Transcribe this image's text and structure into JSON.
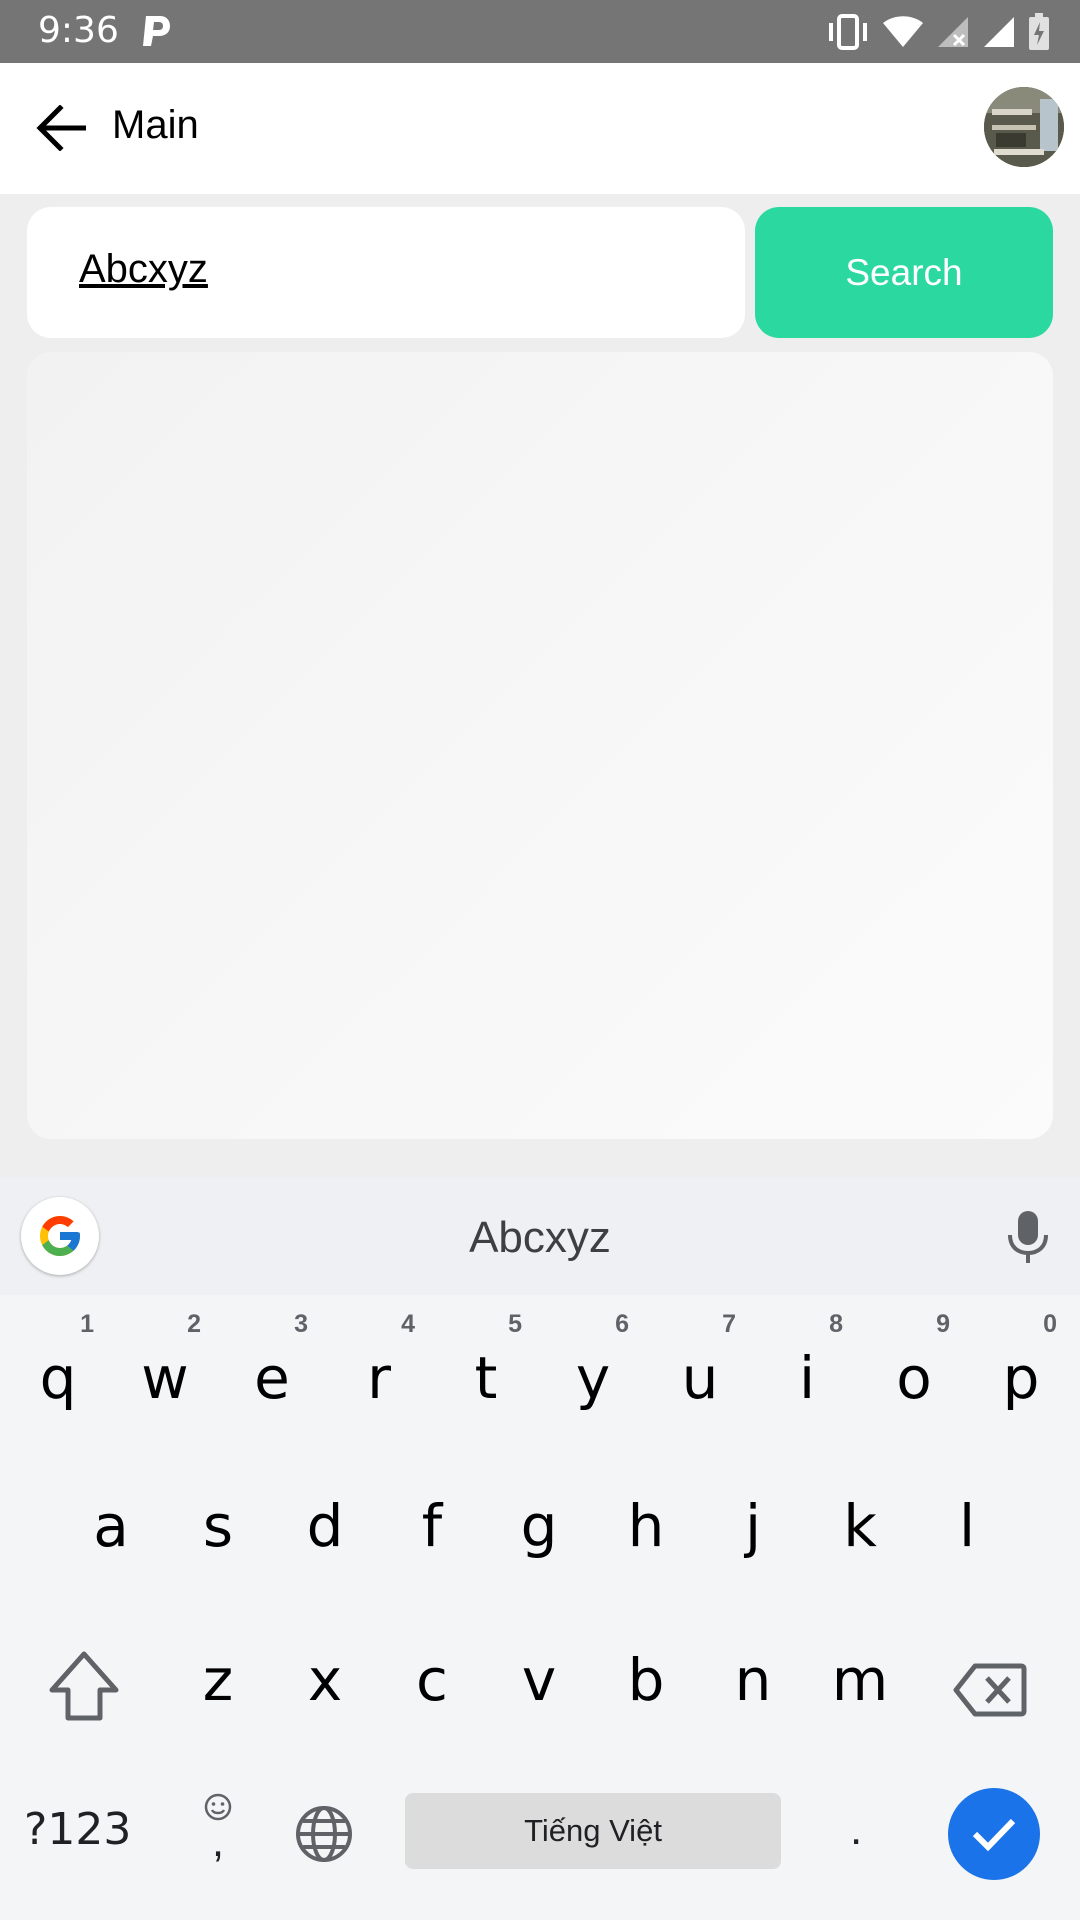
{
  "status_bar": {
    "time": "9:36"
  },
  "app_bar": {
    "title": "Main"
  },
  "search": {
    "value": "Abcxyz",
    "button_label": "Search"
  },
  "colors": {
    "accent": "#2bd89f",
    "status_bar": "#757575",
    "enter_key": "#1a73e8"
  },
  "keyboard": {
    "suggestion": "Abcxyz",
    "row1": [
      {
        "letter": "q",
        "hint": "1"
      },
      {
        "letter": "w",
        "hint": "2"
      },
      {
        "letter": "e",
        "hint": "3"
      },
      {
        "letter": "r",
        "hint": "4"
      },
      {
        "letter": "t",
        "hint": "5"
      },
      {
        "letter": "y",
        "hint": "6"
      },
      {
        "letter": "u",
        "hint": "7"
      },
      {
        "letter": "i",
        "hint": "8"
      },
      {
        "letter": "o",
        "hint": "9"
      },
      {
        "letter": "p",
        "hint": "0"
      }
    ],
    "row2": [
      "a",
      "s",
      "d",
      "f",
      "g",
      "h",
      "j",
      "k",
      "l"
    ],
    "row3": [
      "z",
      "x",
      "c",
      "v",
      "b",
      "n",
      "m"
    ],
    "symbols_label": "?123",
    "comma_label": ",",
    "space_label": "Tiếng Việt",
    "period_label": ".",
    "icons": [
      "google-icon",
      "mic-icon",
      "shift-icon",
      "backspace-icon",
      "emoji-icon",
      "globe-icon",
      "check-icon"
    ]
  }
}
